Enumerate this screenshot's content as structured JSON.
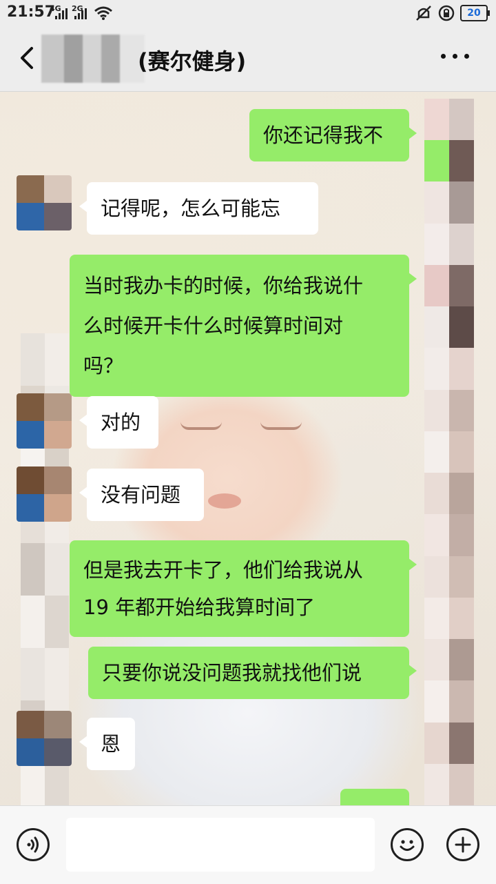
{
  "status_bar": {
    "time": "21:57",
    "network_1": "4G",
    "network_2": "2G",
    "battery": "20",
    "icons": [
      "signal-icon",
      "wifi-icon",
      "mute-icon",
      "lock-icon",
      "battery-icon"
    ]
  },
  "header": {
    "title": "(赛尔健身)",
    "back_icon": "back-arrow-icon",
    "more_icon": "more-dots-icon"
  },
  "messages": [
    {
      "from": "me",
      "lines": [
        "你还记得我不"
      ]
    },
    {
      "from": "them",
      "lines": [
        "记得呢，怎么可能忘"
      ]
    },
    {
      "from": "me",
      "lines": [
        "当时我办卡的时候，你给我说什",
        "么时候开卡什么时候算时间对",
        "吗？"
      ]
    },
    {
      "from": "them",
      "lines": [
        "对的"
      ]
    },
    {
      "from": "them",
      "lines": [
        "没有问题"
      ]
    },
    {
      "from": "me",
      "lines": [
        "但是我去开卡了，他们给我说从",
        "19 年都开始给我算时间了"
      ]
    },
    {
      "from": "me",
      "lines": [
        "只要你说没问题我就找他们说"
      ]
    },
    {
      "from": "them",
      "lines": [
        "恩"
      ]
    },
    {
      "from": "me",
      "lines": [
        ""
      ]
    }
  ],
  "input_bar": {
    "voice_icon": "voice-icon",
    "emoji_icon": "emoji-icon",
    "add_icon": "plus-icon",
    "message_value": ""
  },
  "colors": {
    "my_bubble": "#95ec69",
    "their_bubble": "#ffffff",
    "bar_bg": "#ededed"
  }
}
